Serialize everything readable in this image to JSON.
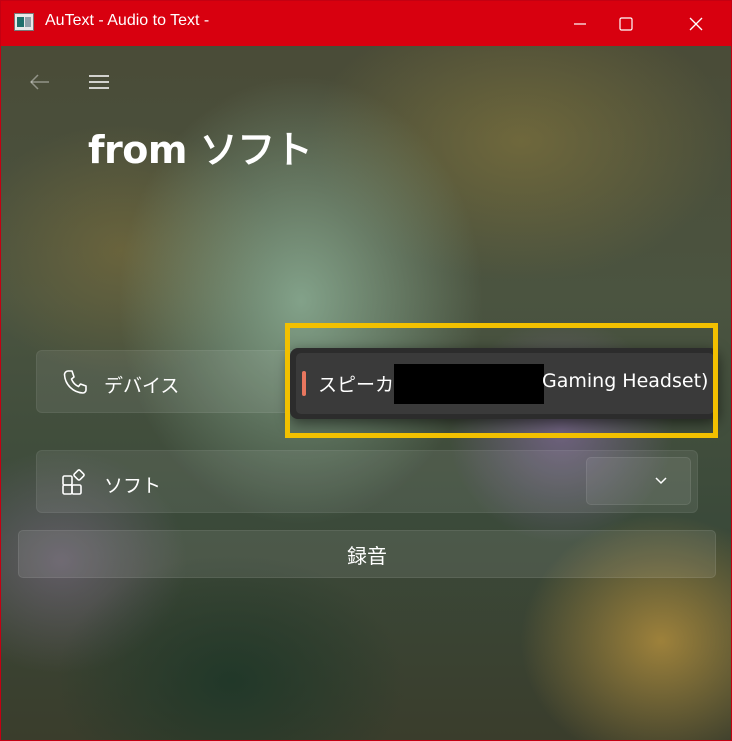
{
  "window": {
    "title": "AuText - Audio to Text -",
    "titlebar_color": "#d8000f",
    "controls": [
      "minimize-icon",
      "maximize-icon",
      "close-icon"
    ]
  },
  "nav": {
    "back_icon": "arrow-left-icon",
    "menu_icon": "hamburger-menu-icon"
  },
  "page": {
    "title": "from ソフト"
  },
  "device_setting": {
    "icon": "phone-icon",
    "label": "デバイス",
    "dropdown": {
      "selected_option": {
        "prefix": "スピーカー",
        "suffix": "Gaming Headset)",
        "redacted": true
      },
      "accent_color": "#e8765e"
    }
  },
  "soft_setting": {
    "icon": "apps-add-icon",
    "label": "ソフト",
    "combo_icon": "chevron-down-icon",
    "value": ""
  },
  "record_button": {
    "label": "録音"
  },
  "annotation": {
    "highlight_color": "#f2c000"
  }
}
